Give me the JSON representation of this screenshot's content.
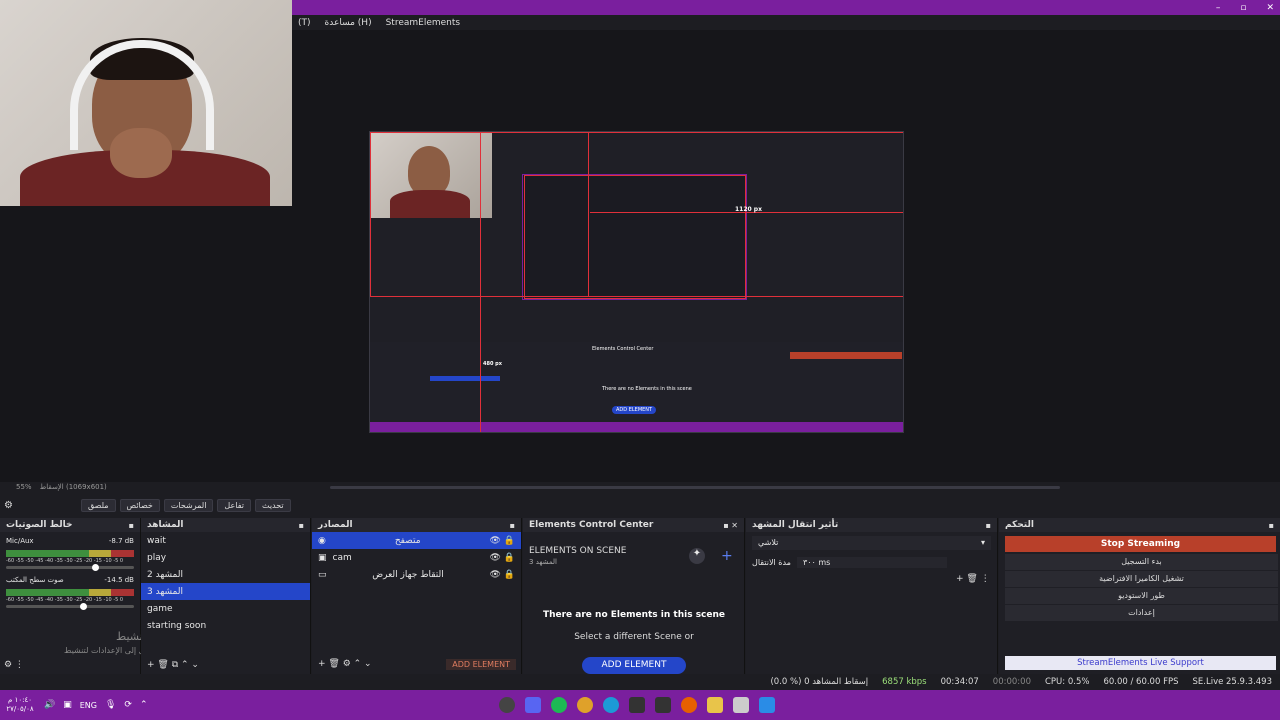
{
  "window": {
    "minimize": "–",
    "maximize": "▫",
    "close": "✕"
  },
  "menu": {
    "help": "مساعدة (H)",
    "streamelements": "StreamElements",
    "frag": "(T)"
  },
  "preview": {
    "zoom": "55%",
    "zoom_hint": "الإسقاط (1069x601)",
    "measure_label": "1120 px",
    "measure_label2": "480 px",
    "inner_ecc_title": "Elements Control Center",
    "inner_no_elements": "There are no Elements in this scene",
    "inner_add": "ADD ELEMENT"
  },
  "toolbar": {
    "mic_icon": "gear-icon",
    "btn_paste": "ملصق",
    "btn_props": "خصائص",
    "btn_filters": "المرشحات",
    "btn_interact": "تفاعل",
    "btn_refresh": "تحديث"
  },
  "mixer": {
    "title": "خالط الصوتيات",
    "tracks": [
      {
        "name": "Mic/Aux",
        "db": "-8.7 dB",
        "scale": "-60 -55 -50 -45 -40 -35 -30 -25 -20 -15 -10 -5 0"
      },
      {
        "name": "صوت سطح المكتب",
        "db": "-14.5 dB",
        "scale": "-60 -55 -50 -45 -40 -35 -30 -25 -20 -15 -10 -5 0"
      }
    ],
    "watermark1": "تنشيط Windows",
    "watermark2": "انتقل إلى الإعدادات لتنشيط Windows."
  },
  "scenes": {
    "title": "المشاهد",
    "items": [
      "wait",
      "play",
      "المشهد 2",
      "المشهد 3",
      "game",
      "starting soon"
    ],
    "selected": 3
  },
  "sources": {
    "title": "المصادر",
    "items": [
      {
        "name": "متصفح",
        "selected": true
      },
      {
        "name": "cam",
        "selected": false
      },
      {
        "name": "التقاط جهاز العرض",
        "selected": false
      }
    ],
    "add_element": "ADD ELEMENT"
  },
  "ecc": {
    "title": "Elements Control Center",
    "on_scene": "ELEMENTS ON SCENE",
    "scene_name": "المشهد 3",
    "empty_title": "There are no Elements in this scene",
    "empty_sub": "Select a different Scene or",
    "add_btn": "ADD ELEMENT"
  },
  "transitions": {
    "title": "تأثير انتقال المشهد",
    "selected": "تلاشي",
    "duration_label": "مدة الانتقال",
    "duration_value": "٣٠٠ ms"
  },
  "controls": {
    "title": "التحكم",
    "stop_streaming": "Stop Streaming",
    "start_recording": "بدء التسجيل",
    "virtual_cam": "تشغيل الكاميرا الافتراضية",
    "studio_mode": "طور الاستوديو",
    "settings": "إعدادات",
    "support": "StreamElements Live Support",
    "accent": "#b8402a"
  },
  "status": {
    "dropped": "(0.0 %) 0 إسقاط المشاهد",
    "bitrate": "6857 kbps",
    "live_time": "00:34:07",
    "rec_time": "00:00:00",
    "cpu": "CPU: 0.5%",
    "fps": "60.00 / 60.00 FPS",
    "version": "SE.Live 25.9.3.493"
  },
  "taskbar": {
    "time": "١٠:٤٠ م",
    "date": "٢٧/٠٥/٠٨",
    "lang": "ENG",
    "color": "#7a1f9e"
  }
}
